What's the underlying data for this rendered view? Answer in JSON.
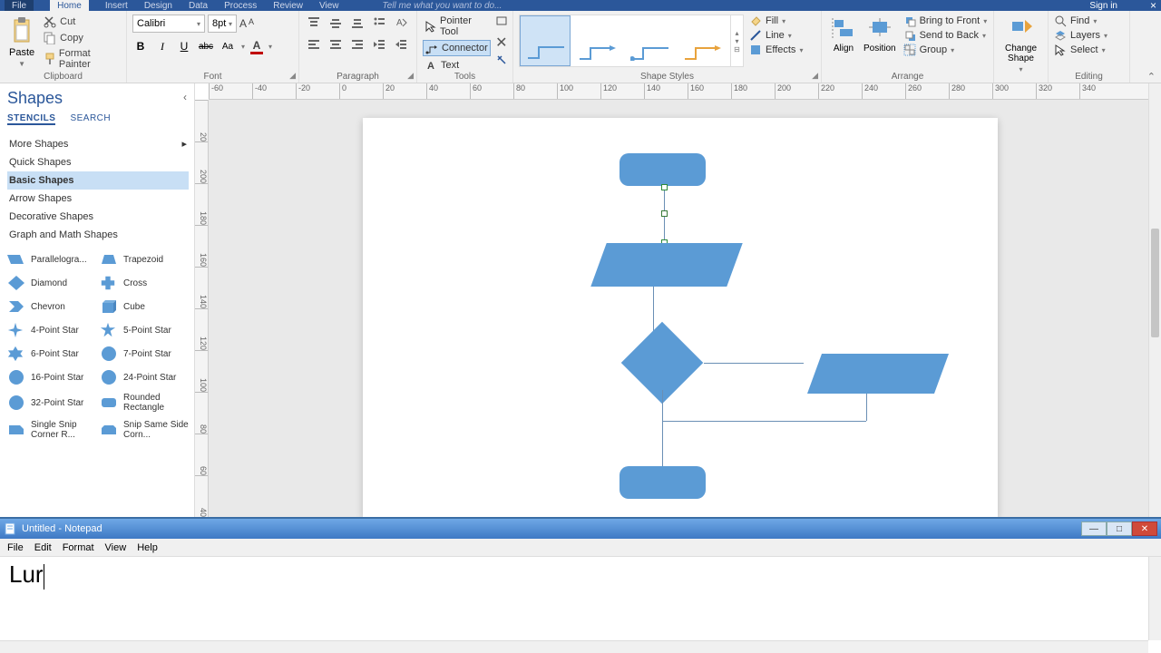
{
  "menubar": {
    "tabs": [
      "File",
      "Home",
      "Insert",
      "Design",
      "Data",
      "Process",
      "Review",
      "View"
    ],
    "active": 1,
    "tell": "Tell me what you want to do...",
    "signin": "Sign in",
    "close": "×"
  },
  "ribbon": {
    "clipboard": {
      "paste": "Paste",
      "cut": "Cut",
      "copy": "Copy",
      "format": "Format Painter",
      "label": "Clipboard"
    },
    "font": {
      "name": "Calibri",
      "size": "8pt",
      "label": "Font",
      "bold": "B",
      "italic": "I",
      "underline": "U",
      "strike": "abc",
      "case": "Aa"
    },
    "paragraph": {
      "label": "Paragraph"
    },
    "tools": {
      "pointer": "Pointer Tool",
      "connector": "Connector",
      "text": "Text",
      "label": "Tools",
      "x": "✕"
    },
    "styles": {
      "label": "Shape Styles",
      "fill": "Fill",
      "line": "Line",
      "effects": "Effects"
    },
    "arrange": {
      "align": "Align",
      "position": "Position",
      "front": "Bring to Front",
      "back": "Send to Back",
      "group": "Group",
      "label": "Arrange"
    },
    "change": {
      "label": "Change Shape",
      "text": "Change\nShape"
    },
    "editing": {
      "find": "Find",
      "layers": "Layers",
      "select": "Select",
      "label": "Editing"
    }
  },
  "panel": {
    "title": "Shapes",
    "tabs": [
      "STENCILS",
      "SEARCH"
    ],
    "activeTab": 0,
    "more": "More Shapes",
    "cats": [
      "Quick Shapes",
      "Basic Shapes",
      "Arrow Shapes",
      "Decorative Shapes",
      "Graph and Math Shapes"
    ],
    "activeCat": 1,
    "shapes": [
      {
        "name": "Parallelogra...",
        "icon": "para"
      },
      {
        "name": "Trapezoid",
        "icon": "trap"
      },
      {
        "name": "Diamond",
        "icon": "dia"
      },
      {
        "name": "Cross",
        "icon": "cross"
      },
      {
        "name": "Chevron",
        "icon": "chev"
      },
      {
        "name": "Cube",
        "icon": "cube"
      },
      {
        "name": "4-Point Star",
        "icon": "star4"
      },
      {
        "name": "5-Point Star",
        "icon": "star5"
      },
      {
        "name": "6-Point Star",
        "icon": "star6"
      },
      {
        "name": "7-Point Star",
        "icon": "star7"
      },
      {
        "name": "16-Point Star",
        "icon": "star16"
      },
      {
        "name": "24-Point Star",
        "icon": "star24"
      },
      {
        "name": "32-Point Star",
        "icon": "star32"
      },
      {
        "name": "Rounded Rectangle",
        "icon": "rrect"
      },
      {
        "name": "Single Snip Corner R...",
        "icon": "snip1"
      },
      {
        "name": "Snip Same Side Corn...",
        "icon": "snip2"
      }
    ]
  },
  "ruler_h": [
    "-60",
    "-40",
    "-20",
    "0",
    "20",
    "40",
    "60",
    "80",
    "100",
    "120",
    "140",
    "160",
    "180",
    "200",
    "220",
    "240",
    "260",
    "280",
    "300",
    "320",
    "340"
  ],
  "ruler_v": [
    "20",
    "200",
    "180",
    "160",
    "140",
    "120",
    "100",
    "80",
    "60",
    "40"
  ],
  "notepad": {
    "title": "Untitled - Notepad",
    "menu": [
      "File",
      "Edit",
      "Format",
      "View",
      "Help"
    ],
    "content": "Lur"
  },
  "colors": {
    "accent": "#5b9bd5",
    "ribbon": "#f1f1f1",
    "menubar": "#2b579a",
    "fontred": "#c00000"
  }
}
